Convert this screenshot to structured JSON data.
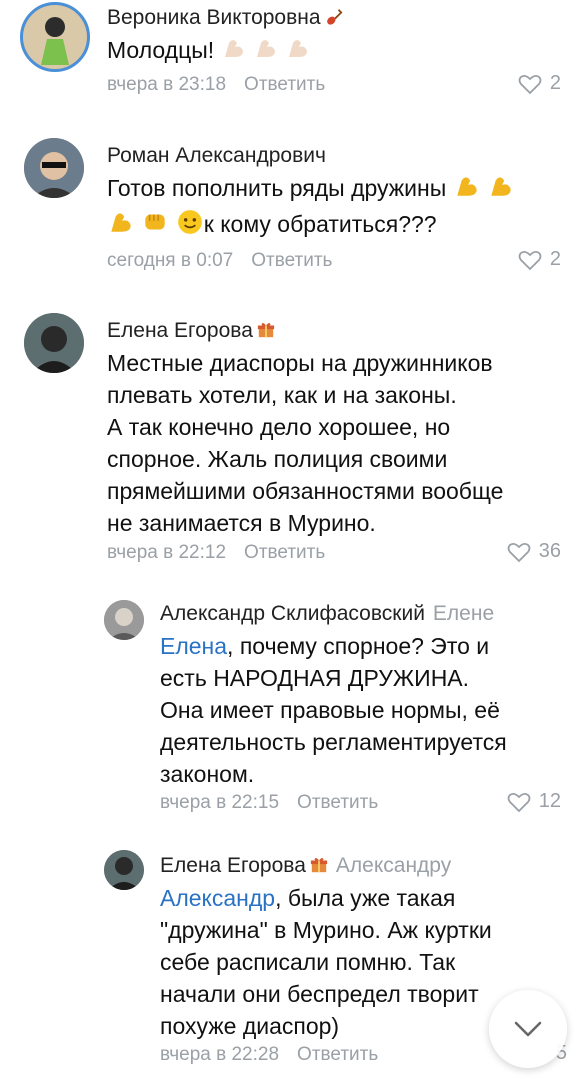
{
  "comments": [
    {
      "author": "Вероника Викторовна",
      "author_badge": "guitar-icon",
      "text": "Молодцы!",
      "emojis": [
        "flexed-biceps-icon",
        "flexed-biceps-icon",
        "flexed-biceps-icon"
      ],
      "time": "вчера в 23:18",
      "reply_label": "Ответить",
      "likes": "2"
    },
    {
      "author": "Роман Александрович",
      "line1": "Готов пополнить ряды дружины",
      "line2": "к кому обратиться???",
      "time": "сегодня в 0:07",
      "reply_label": "Ответить",
      "likes": "2"
    },
    {
      "author": "Елена Егорова",
      "author_badge": "gift-icon",
      "lines": [
        "Местные диаспоры на дружинников",
        "плевать хотели, как и на законы.",
        "А так конечно дело хорошее, но",
        "спорное. Жаль полиция своими",
        "прямейшими обязанностями вообще",
        "не занимается в Мурино."
      ],
      "time": "вчера в 22:12",
      "reply_label": "Ответить",
      "likes": "36"
    },
    {
      "author": "Александр Склифасовский",
      "reply_to": "Елене",
      "mention": "Елена",
      "first_line_rest": ", почему спорное? Это и",
      "lines": [
        "есть НАРОДНАЯ ДРУЖИНА.",
        "Она имеет правовые нормы, её",
        "деятельность регламентируется",
        "законом."
      ],
      "time": "вчера в 22:15",
      "reply_label": "Ответить",
      "likes": "12"
    },
    {
      "author": "Елена Егорова",
      "author_badge": "gift-icon",
      "reply_to": "Александру",
      "mention": "Александр",
      "first_line_rest": ", была уже такая",
      "lines": [
        "\"дружина\" в Мурино. Аж куртки",
        "себе расписали помню. Так",
        "начали они беспредел творит",
        "похуже диаспор)"
      ],
      "time": "вчера в 22:28",
      "reply_label": "Ответить",
      "likes": "5"
    }
  ],
  "colors": {
    "meta": "#9aa0a6",
    "mention": "#2a72c4",
    "text": "#111111"
  }
}
